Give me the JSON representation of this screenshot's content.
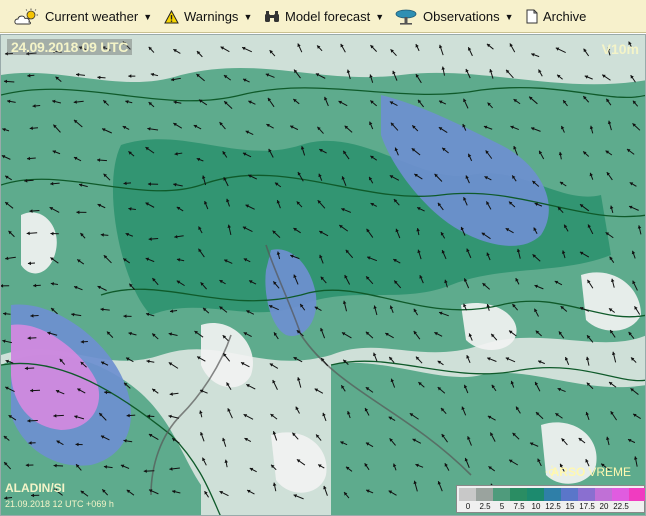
{
  "menu": {
    "items": [
      {
        "label": "Current weather",
        "icon": "cloud-sun-icon",
        "has_dropdown": true
      },
      {
        "label": "Warnings",
        "icon": "warning-icon",
        "has_dropdown": true
      },
      {
        "label": "Model forecast",
        "icon": "binoculars-icon",
        "has_dropdown": true
      },
      {
        "label": "Observations",
        "icon": "station-icon",
        "has_dropdown": true
      },
      {
        "label": "Archive",
        "icon": "document-icon",
        "has_dropdown": false
      }
    ]
  },
  "map": {
    "valid_time": "24.09.2018 09 UTC",
    "parameter": "V10m",
    "model": "ALADIN/SI",
    "run_info": "21.09.2018 12 UTC +069 h",
    "brand": "ARSO",
    "brand_sub": "VREME",
    "legend": {
      "ticks": [
        "0",
        "2.5",
        "5",
        "7.5",
        "10",
        "12.5",
        "15",
        "17.5",
        "20",
        "22.5"
      ],
      "colors": [
        "#c8c8c8",
        "#9aa39e",
        "#4f9b7c",
        "#2a8d63",
        "#1c8a6e",
        "#2f7fa8",
        "#5a76c9",
        "#8a6fd0",
        "#c070d6",
        "#e05ce0",
        "#f03cc0"
      ]
    },
    "colors": {
      "calm": "#f2f2f2",
      "light": "#cfe0d8",
      "moderate": "#55a687",
      "strong": "#2f9270",
      "stronger": "#6e8fd0",
      "strongest": "#d48ae0"
    }
  }
}
